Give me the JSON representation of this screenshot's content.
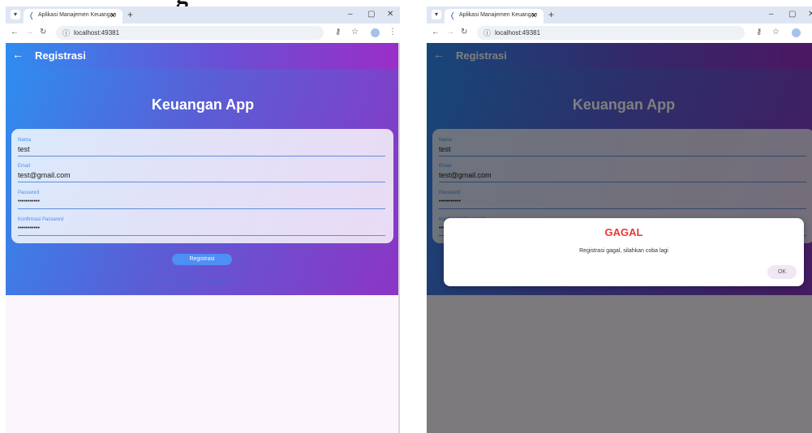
{
  "heading_fragment": "g",
  "browser": {
    "tab_title": "Aplikasi Manajemen Keuangan",
    "tab_close": "✕",
    "new_tab": "+",
    "url": "localhost:49381",
    "minimize": "–",
    "restore": "▢",
    "close": "✕"
  },
  "screen_left": {
    "appbar_title": "Registrasi",
    "app_title": "Keuangan App",
    "fields": [
      {
        "label": "Nama",
        "value": "test"
      },
      {
        "label": "Email",
        "value": "test@gmail.com"
      },
      {
        "label": "Password",
        "value": "•••••••••••"
      },
      {
        "label": "Konfirmasi Password",
        "value": "•••••••••••"
      }
    ],
    "register_button": "Registrasi",
    "login_link": "Sudah punya akun? Login di sini"
  },
  "screen_right": {
    "appbar_title": "Registrasi",
    "app_title": "Keuangan App",
    "fields": [
      {
        "label": "Nama",
        "value": "test"
      },
      {
        "label": "Email",
        "value": "test@gmail.com"
      },
      {
        "label": "Password",
        "value": "•••••••••••"
      },
      {
        "label": "Konfirmasi Password",
        "value": "•••••••••••"
      }
    ],
    "dialog": {
      "title": "GAGAL",
      "message": "Registrasi gagal, silahkan coba lagi",
      "ok_button": "OK"
    }
  },
  "colors": {
    "gradient_start": "#2d8ff0",
    "gradient_end": "#8c35c4",
    "button": "#4e8ef5",
    "error_title": "#e53935"
  }
}
